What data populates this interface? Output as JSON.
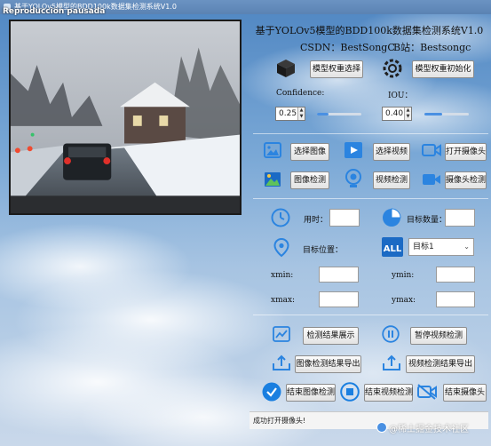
{
  "window": {
    "title": "基于YOLOv5模型的BDD100k数据集检测系统V1.0",
    "overlay_label": "Reproducción pausada"
  },
  "header": {
    "title": "基于YOLOv5模型的BDD100k数据集检测系统V1.0",
    "csdn": "CSDN：BestSongC",
    "bilibili": "B站：Bestsongc"
  },
  "model": {
    "select_label": "模型权重选择",
    "init_label": "模型权重初始化"
  },
  "params": {
    "confidence_label": "Confidence:",
    "confidence_value": "0.25",
    "confidence_fill": 0.25,
    "iou_label": "IOU：",
    "iou_value": "0.40",
    "iou_fill": 0.4
  },
  "source": {
    "select_image": "选择图像",
    "select_video": "选择视频",
    "open_camera": "打开摄像头",
    "image_detect": "图像检测",
    "video_detect": "视频检测",
    "camera_detect": "摄像头检测"
  },
  "info": {
    "time_label": "用时：",
    "count_label": "目标数量：",
    "position_label": "目标位置：",
    "target_select": "目标1",
    "xmin": "xmin:",
    "ymin": "ymin:",
    "xmax": "xmax:",
    "ymax": "ymax:"
  },
  "actions": {
    "show_result": "检测结果展示",
    "pause_video": "暂停视频检测",
    "export_image": "图像检测结果导出",
    "export_video": "视频检测结果导出",
    "end_image": "结束图像检测",
    "end_video": "结束视频检测",
    "end_camera": "结束摄像头"
  },
  "status": {
    "text": "成功打开摄像头!"
  },
  "watermark": {
    "text": "@稀土掘金技术社区"
  },
  "colors": {
    "accent": "#1a7fe0",
    "icon_blue": "#2b84e0"
  }
}
